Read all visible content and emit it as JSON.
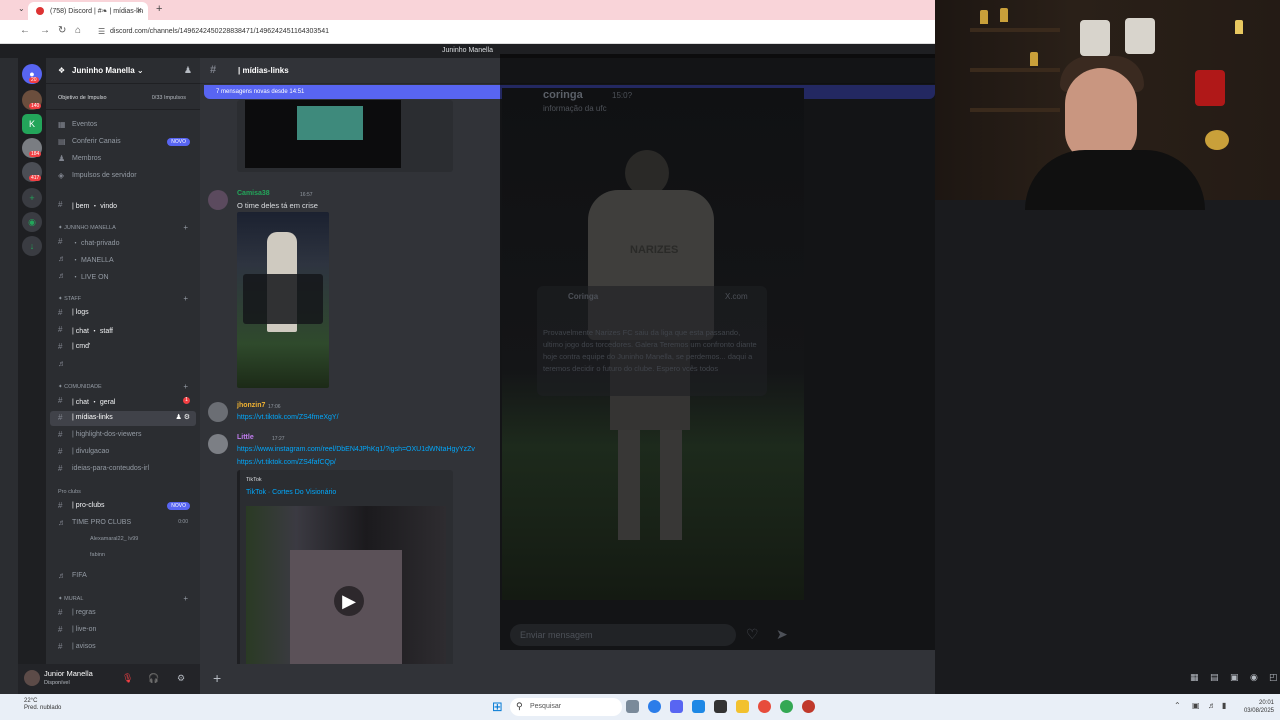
{
  "browser": {
    "tab_title": "(758) Discord | #❧ | mídias-lin",
    "url": "discord.com/channels/1496242450228838471/1496242451164303541"
  },
  "window_title": "Juninho Manella",
  "server": {
    "name": "Juninho Manella",
    "boost_label": "Objetivo de Impulso",
    "boost_count": "0/33 Impulsos"
  },
  "guild_badges": [
    "20",
    "140",
    "184",
    "417"
  ],
  "channels": {
    "events": "Eventos",
    "browse": "Conferir Canais",
    "members": "Membros",
    "boosts": "Impulsos de servidor",
    "novo": "NOVO",
    "bem_vindo": "| bem ・ vindo",
    "cat_juninho": "✦ JUNINHO MANELLA",
    "chat_privado": "・ chat-privado",
    "manella": "・ MANELLA",
    "live_on": "・ LIVE ON",
    "cat_staff": "✦ STAFF",
    "logs": "| logs",
    "chat_staff": "| chat ・ staff",
    "cmd": "| cmd'",
    "cat_comunidade": "✦ COMUNIDADE",
    "chat_geral": "| chat ・ geral",
    "chat_geral_badge": "1",
    "midias_links": "| mídias-links",
    "highlight": "| highlight-dos-viewers",
    "divulgacao": "| divulgacao",
    "ideias": "ideias-para-conteudos-irl",
    "cat_proclubs": "Pro clubs",
    "pro_clubs": "| pro-clubs",
    "time_pro": "TIME PRO CLUBS",
    "time_pro_time": "0:00",
    "voice_user1": "Alexamaral22_",
    "voice_user1_tag": "lv99",
    "voice_user2": "fabinn",
    "fifa": "FIFA",
    "cat_mural": "✦ MURAL",
    "regras": "| regras",
    "live_on_mural": "| live-on",
    "avisos": "| avisos"
  },
  "user": {
    "name": "Junior Manella",
    "status": "Disponível"
  },
  "chat": {
    "channel": "| mídias-links",
    "new_messages": "7 mensagens novas desde 14:51",
    "msg1_author": "Camisa38",
    "msg1_time": "16:57",
    "msg1_text": "O time deles tá em crise",
    "msg2_author": "jhonzin7",
    "msg2_time": "17:06",
    "msg2_link": "https://vt.tiktok.com/ZS4fmeXgY/",
    "msg3_author": "Little",
    "msg3_time": "17:27",
    "msg3_link1": "https://www.instagram.com/reel/DbEN4JPhKq1/?igsh=OXU1dWNtaHgyYzZv",
    "msg3_link2": "https://vt.tiktok.com/ZS4fafCQp/",
    "embed_provider": "TikTok",
    "embed_title": "TikTok · Cortes Do Visionário"
  },
  "lightbox": {
    "name": "coringa",
    "time": "15:0?",
    "subtitle": "informação da ufc",
    "card_name": "Coringa",
    "card_source": "X.com",
    "card_body": "Provavelmente Narizes FC saiu da liga que esta passando, ultimo jogo dos torcedores. Galera Teremos um confronto diante hoje contra equipe do Juninho Manella, se perdemos... daqui a teremos decidir o futuro do clube. Espero vcês todos",
    "jersey_text": "NARIZES",
    "input_placeholder": "Enviar mensagem"
  },
  "taskbar": {
    "temp": "22°C",
    "weather": "Pred. nublado",
    "search": "Pesquisar",
    "time": "20:01",
    "date": "03/08/2025"
  }
}
